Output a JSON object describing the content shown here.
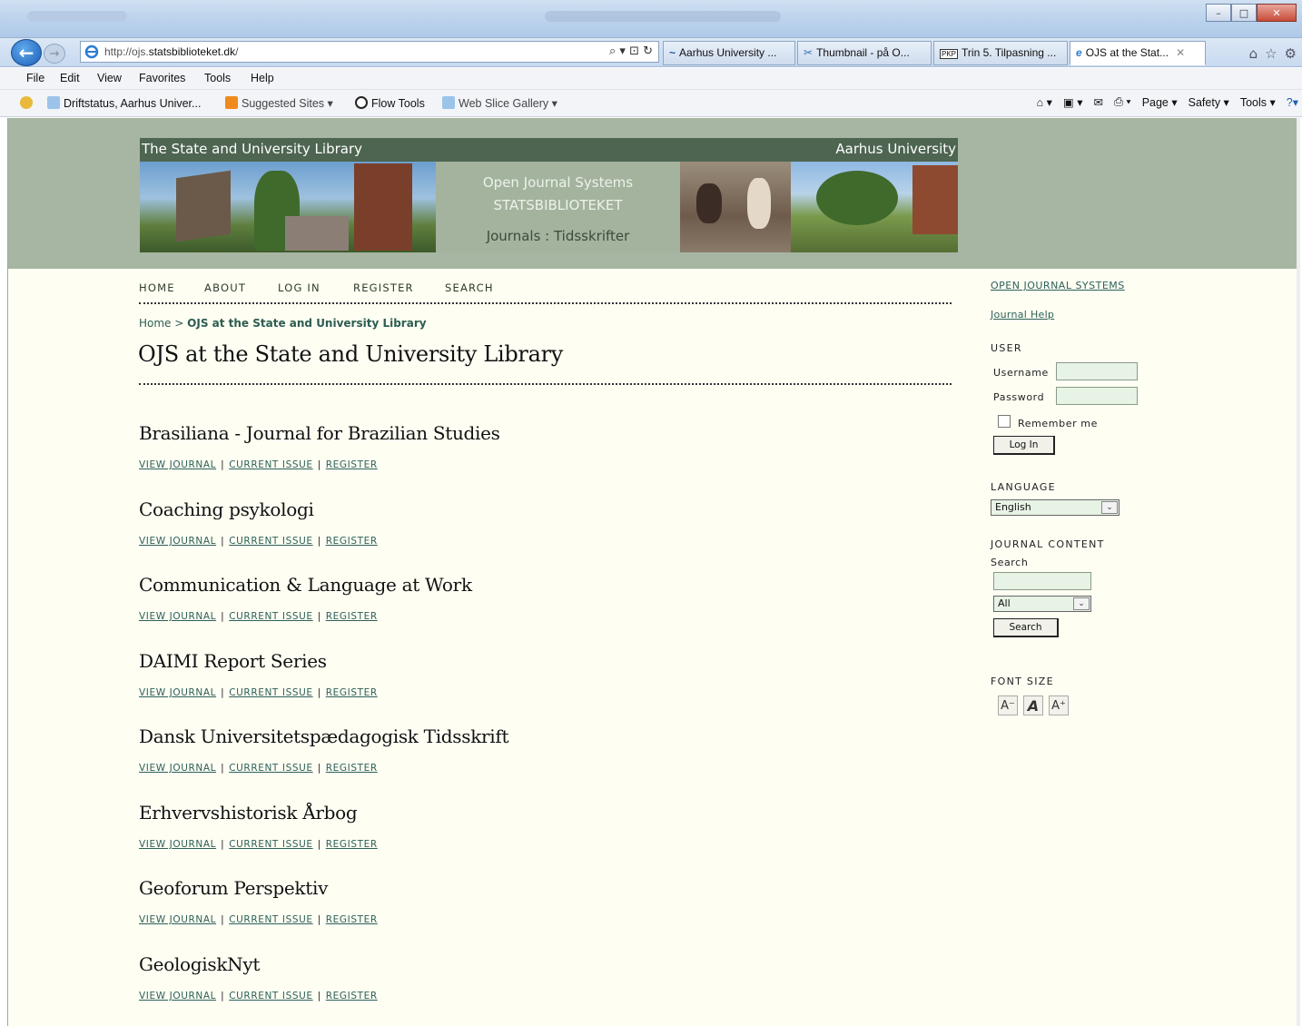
{
  "browser": {
    "back_glyph": "←",
    "forward_glyph": "→",
    "url_prefix": "http://ojs.",
    "url_domain": "statsbiblioteket.dk",
    "url_suffix": "/",
    "address_tools": "⌕ ▾ ⊡ ↻",
    "tabs": [
      {
        "label": "Aarhus University ...",
        "icon": "~"
      },
      {
        "label": "Thumbnail - på O...",
        "icon": "✂"
      },
      {
        "label": "Trin 5. Tilpasning ...",
        "icon": "PKP"
      },
      {
        "label": "OJS at the Stat...",
        "icon": "e",
        "close": "✕"
      }
    ],
    "menu": [
      "File",
      "Edit",
      "View",
      "Favorites",
      "Tools",
      "Help"
    ],
    "favorites": [
      {
        "label": "Driftstatus, Aarhus Univer..."
      },
      {
        "label": "Suggested Sites ▾"
      },
      {
        "label": "Flow Tools"
      },
      {
        "label": "Web Slice Gallery ▾"
      }
    ],
    "commands": [
      "Page ▾",
      "Safety ▾",
      "Tools ▾"
    ],
    "window_buttons": {
      "minimize": "–",
      "maximize": "□",
      "close": "✕"
    }
  },
  "site": {
    "banner_left": "The State and University Library",
    "banner_right": "Aarhus University",
    "center_line1": "Open Journal Systems",
    "center_line2": "STATSBIBLIOTEKET",
    "center_line3": "Journals : Tidsskrifter"
  },
  "nav": [
    "HOME",
    "ABOUT",
    "LOG IN",
    "REGISTER",
    "SEARCH"
  ],
  "breadcrumb": {
    "home": "Home",
    "separator": ">",
    "current": "OJS at the State and University Library"
  },
  "page_title": "OJS at the State and University Library",
  "journal_links": {
    "view": "VIEW JOURNAL",
    "current": "CURRENT ISSUE",
    "register": "REGISTER",
    "separator": "|"
  },
  "journals": [
    "Brasiliana - Journal for Brazilian Studies",
    "Coaching psykologi",
    "Communication & Language at Work",
    "DAIMI Report Series",
    "Dansk Universitetspædagogisk Tidsskrift",
    "Erhvervshistorisk Årbog",
    "Geoforum Perspektiv",
    "GeologiskNyt"
  ],
  "sidebar": {
    "ojs_link": "OPEN JOURNAL SYSTEMS",
    "help_link": "Journal Help",
    "user_heading": "USER",
    "username_label": "Username",
    "password_label": "Password",
    "remember_label": "Remember me",
    "login_button": "Log In",
    "language_heading": "LANGUAGE",
    "language_value": "English",
    "content_heading": "JOURNAL CONTENT",
    "search_label": "Search",
    "scope_value": "All",
    "search_button": "Search",
    "fontsize_heading": "FONT SIZE",
    "font_buttons": [
      "A⁻",
      "A",
      "A⁺"
    ]
  },
  "colors": {
    "header_green": "#a7b6a2",
    "banner_dark": "#4d6551",
    "link": "#2d6058",
    "page_bg": "#fefef3"
  }
}
